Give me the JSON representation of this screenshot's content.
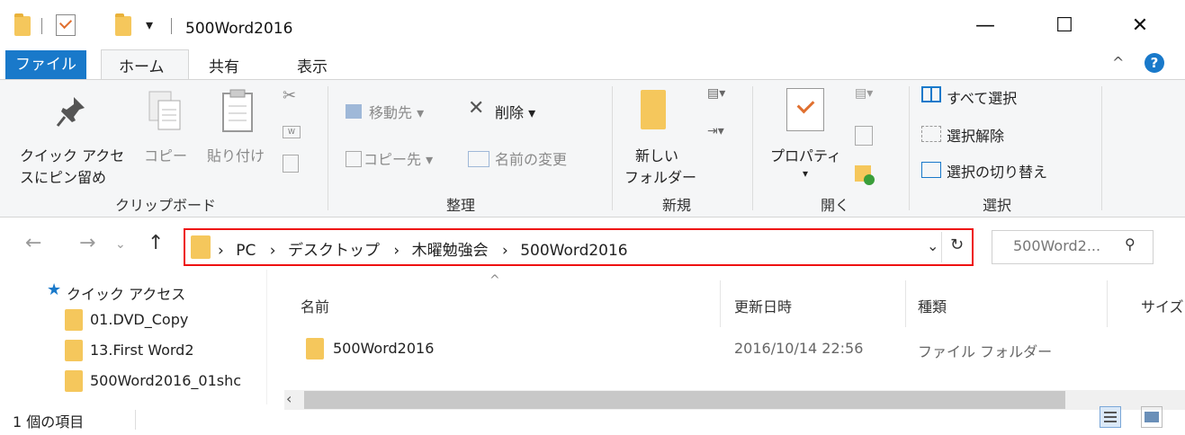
{
  "window": {
    "title": "500Word2016",
    "minimize_glyph": "—",
    "maximize_glyph": "☐",
    "close_glyph": "✕",
    "qat_dropdown_glyph": "▾"
  },
  "ribbon": {
    "tabs": {
      "file": "ファイル",
      "home": "ホーム",
      "share": "共有",
      "view": "表示"
    },
    "collapse_glyph": "^",
    "help_glyph": "?",
    "clipboard": {
      "pin_label_1": "クイック アクセ",
      "pin_label_2": "スにピン留め",
      "copy_label": "コピー",
      "paste_label": "貼り付け",
      "group_label": "クリップボード"
    },
    "organize": {
      "move_to": "移動先",
      "copy_to": "コピー先",
      "delete": "削除",
      "rename": "名前の変更",
      "group_label": "整理"
    },
    "new": {
      "new_folder_1": "新しい",
      "new_folder_2": "フォルダー",
      "group_label": "新規"
    },
    "open": {
      "properties": "プロパティ",
      "group_label": "開く"
    },
    "select": {
      "select_all": "すべて選択",
      "select_none": "選択解除",
      "invert": "選択の切り替え",
      "group_label": "選択"
    }
  },
  "address": {
    "crumbs": [
      "PC",
      "デスクトップ",
      "木曜勉強会",
      "500Word2016"
    ],
    "sep": "›",
    "search_placeholder": "500Word2... "
  },
  "nav": {
    "quick_access": "クイック アクセス",
    "items": [
      "01.DVD_Copy",
      "13.First Word2",
      "500Word2016_01shc"
    ]
  },
  "columns": {
    "name": "名前",
    "date": "更新日時",
    "type": "種類",
    "size": "サイズ"
  },
  "files": [
    {
      "name": "500Word2016",
      "date": "2016/10/14 22:56",
      "type": "ファイル フォルダー"
    }
  ],
  "status": {
    "count": "1 個の項目"
  },
  "colors": {
    "accent": "#1979ca",
    "folder": "#f5c75c",
    "highlight_border": "#ee1111"
  }
}
